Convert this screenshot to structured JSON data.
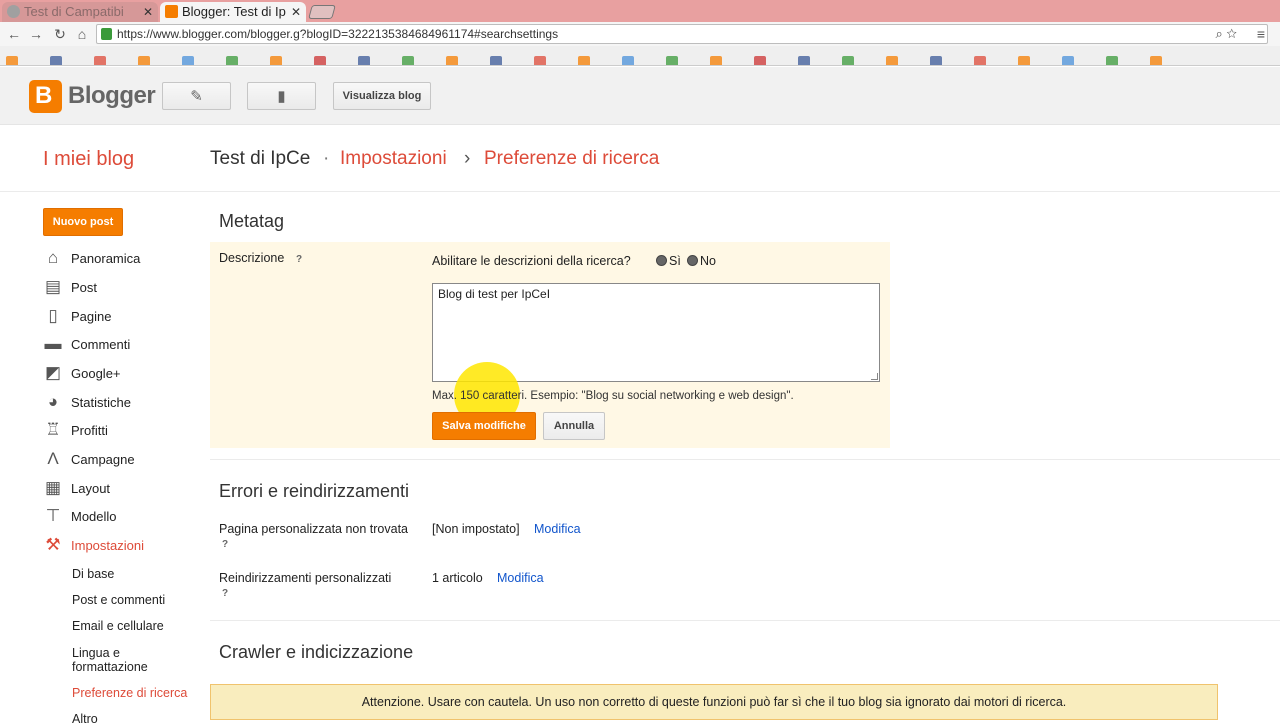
{
  "browser": {
    "tabs": [
      {
        "title": "Test di Campatibi",
        "active": false
      },
      {
        "title": "Blogger: Test di Ip",
        "active": true
      }
    ],
    "url": "https://www.blogger.com/blogger.g?blogID=3222135384684961174#searchsettings",
    "bookmarks": [
      "",
      "",
      "",
      "",
      "",
      "",
      "",
      "",
      "",
      "",
      "",
      "",
      "",
      "",
      "",
      "",
      "",
      "",
      "",
      "",
      "",
      "",
      "",
      "",
      "",
      "",
      ""
    ]
  },
  "header": {
    "logo_text": "Blogger",
    "view_blog_label": "Visualizza blog"
  },
  "titlebar": {
    "my_blogs": "I miei blog",
    "blog_name": "Test di IpCe",
    "separator1": "·",
    "section": "Impostazioni",
    "separator2": "›",
    "page": "Preferenze di ricerca"
  },
  "sidebar": {
    "new_post": "Nuovo post",
    "items": [
      {
        "label": "Panoramica",
        "icon": "home-icon"
      },
      {
        "label": "Post",
        "icon": "posts-icon"
      },
      {
        "label": "Pagine",
        "icon": "pages-icon"
      },
      {
        "label": "Commenti",
        "icon": "comments-icon"
      },
      {
        "label": "Google+",
        "icon": "google-plus-icon"
      },
      {
        "label": "Statistiche",
        "icon": "stats-icon"
      },
      {
        "label": "Profitti",
        "icon": "trophy-icon"
      },
      {
        "label": "Campagne",
        "icon": "campaigns-icon"
      },
      {
        "label": "Layout",
        "icon": "layout-icon"
      },
      {
        "label": "Modello",
        "icon": "template-icon"
      },
      {
        "label": "Impostazioni",
        "icon": "wrench-icon"
      }
    ],
    "subitems": [
      "Di base",
      "Post e commenti",
      "Email e cellulare",
      "Lingua e formattazione",
      "Preferenze di ricerca",
      "Altro"
    ]
  },
  "metatag": {
    "title": "Metatag",
    "description_label": "Descrizione",
    "help": "?",
    "enable_question": "Abilitare le descrizioni della ricerca?",
    "option_yes": "Sì",
    "option_no": "No",
    "textarea_value": "Blog di test per IpCeI",
    "hint": "Max. 150 caratteri. Esempio: \"Blog su social networking e web design\".",
    "save_label": "Salva modifiche",
    "cancel_label": "Annulla"
  },
  "errors": {
    "title": "Errori e reindirizzamenti",
    "not_found_label": "Pagina personalizzata non trovata",
    "not_found_value": "[Non impostato]",
    "redirects_label": "Reindirizzamenti personalizzati",
    "redirects_value": "1 articolo",
    "edit_link": "Modifica",
    "help": "?"
  },
  "crawler": {
    "title": "Crawler e indicizzazione",
    "warning": "Attenzione. Usare con cautela. Un uso non corretto di queste funzioni può far sì che il tuo blog sia ignorato dai motori di ricerca."
  },
  "colors": {
    "brand_orange": "#f57d00",
    "link_red": "#dd4b39",
    "link_blue": "#1155cc"
  }
}
